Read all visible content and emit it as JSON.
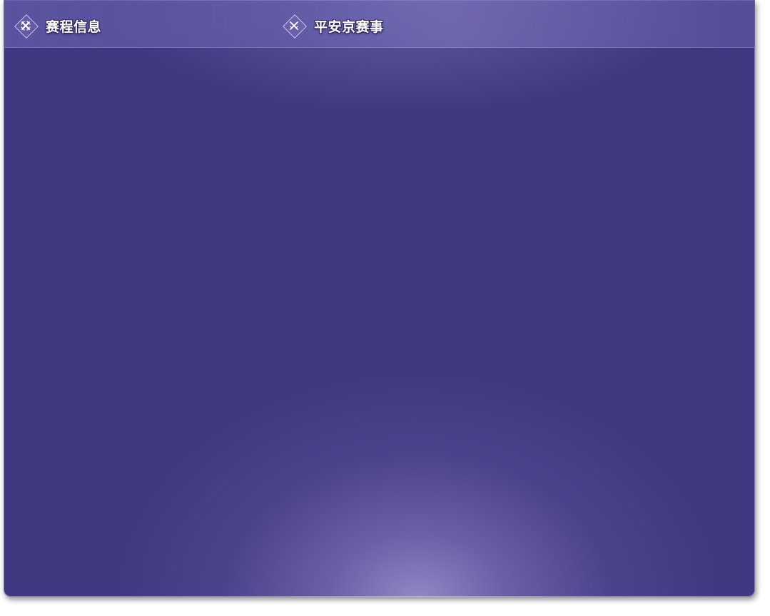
{
  "tabs": {
    "schedule": {
      "label": "赛程信息",
      "icon": "crossed-swords-icon"
    },
    "events": {
      "label": "平安京赛事",
      "icon": "crossed-swords-icon"
    }
  },
  "colors": {
    "panel_base": "#3f3880",
    "panel_glow": "#8c82c0",
    "text": "#ffffff"
  }
}
